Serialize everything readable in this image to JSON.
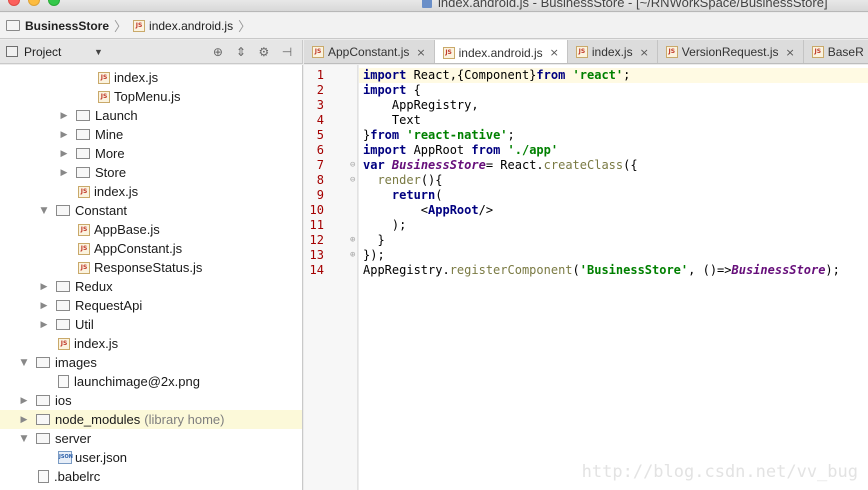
{
  "window": {
    "title": "index.android.js - BusinessStore - [~/RNWorkSpace/BusinessStore]"
  },
  "breadcrumb": {
    "project": "BusinessStore",
    "file": "index.android.js"
  },
  "project_panel": {
    "label": "Project"
  },
  "tabs": [
    {
      "label": "AppConstant.js",
      "active": false,
      "closable": true
    },
    {
      "label": "index.android.js",
      "active": true,
      "closable": true
    },
    {
      "label": "index.js",
      "active": false,
      "closable": true
    },
    {
      "label": "VersionRequest.js",
      "active": false,
      "closable": true
    },
    {
      "label": "BaseR",
      "active": false,
      "closable": false
    }
  ],
  "tree": [
    {
      "label": "index.js",
      "type": "js",
      "depth": 5
    },
    {
      "label": "TopMenu.js",
      "type": "js",
      "depth": 5
    },
    {
      "label": "Launch",
      "type": "folder",
      "depth": 3,
      "expanded": false
    },
    {
      "label": "Mine",
      "type": "folder",
      "depth": 3,
      "expanded": false
    },
    {
      "label": "More",
      "type": "folder",
      "depth": 3,
      "expanded": false
    },
    {
      "label": "Store",
      "type": "folder",
      "depth": 3,
      "expanded": false
    },
    {
      "label": "index.js",
      "type": "js",
      "depth": 4
    },
    {
      "label": "Constant",
      "type": "folder",
      "depth": 2,
      "expanded": true
    },
    {
      "label": "AppBase.js",
      "type": "js",
      "depth": 4
    },
    {
      "label": "AppConstant.js",
      "type": "js",
      "depth": 4
    },
    {
      "label": "ResponseStatus.js",
      "type": "js",
      "depth": 4
    },
    {
      "label": "Redux",
      "type": "folder",
      "depth": 2,
      "expanded": false
    },
    {
      "label": "RequestApi",
      "type": "folder",
      "depth": 2,
      "expanded": false
    },
    {
      "label": "Util",
      "type": "folder",
      "depth": 2,
      "expanded": false
    },
    {
      "label": "index.js",
      "type": "js",
      "depth": 3
    },
    {
      "label": "images",
      "type": "folder",
      "depth": 1,
      "expanded": true
    },
    {
      "label": "launchimage@2x.png",
      "type": "file",
      "depth": 3
    },
    {
      "label": "ios",
      "type": "folder",
      "depth": 1,
      "expanded": false
    },
    {
      "label": "node_modules",
      "type": "folder",
      "depth": 1,
      "expanded": false,
      "suffix": "(library home)",
      "highlight": true
    },
    {
      "label": "server",
      "type": "folder",
      "depth": 1,
      "expanded": true
    },
    {
      "label": "user.json",
      "type": "json",
      "depth": 3
    },
    {
      "label": ".babelrc",
      "type": "file",
      "depth": 2
    }
  ],
  "code": {
    "line_numbers": [
      "1",
      "2",
      "3",
      "4",
      "5",
      "6",
      "7",
      "8",
      "9",
      "10",
      "11",
      "12",
      "13",
      "14"
    ],
    "lines": [
      [
        [
          "kw",
          "import"
        ],
        [
          "p",
          " React,{Component}"
        ],
        [
          "kw",
          "from"
        ],
        [
          "p",
          " "
        ],
        [
          "str",
          "'react'"
        ],
        [
          "p",
          ";"
        ]
      ],
      [
        [
          "kw",
          "import"
        ],
        [
          "p",
          " {"
        ]
      ],
      [
        [
          "p",
          "    AppRegistry,"
        ]
      ],
      [
        [
          "p",
          "    Text"
        ]
      ],
      [
        [
          "p",
          "}"
        ],
        [
          "kw",
          "from"
        ],
        [
          "p",
          " "
        ],
        [
          "str",
          "'react-native'"
        ],
        [
          "p",
          ";"
        ]
      ],
      [
        [
          "kw",
          "import"
        ],
        [
          "p",
          " AppRoot "
        ],
        [
          "kw",
          "from"
        ],
        [
          "p",
          " "
        ],
        [
          "str",
          "'./app'"
        ]
      ],
      [
        [
          "kw",
          "var"
        ],
        [
          "p",
          " "
        ],
        [
          "ital",
          "BusinessStore"
        ],
        [
          "p",
          "= React."
        ],
        [
          "fn",
          "createClass"
        ],
        [
          "p",
          "({"
        ]
      ],
      [
        [
          "p",
          "  "
        ],
        [
          "fn",
          "render"
        ],
        [
          "p",
          "(){"
        ]
      ],
      [
        [
          "p",
          "    "
        ],
        [
          "kw",
          "return"
        ],
        [
          "p",
          "("
        ]
      ],
      [
        [
          "p",
          "        <"
        ],
        [
          "jsx",
          "AppRoot"
        ],
        [
          "p",
          "/>"
        ]
      ],
      [
        [
          "p",
          "    );"
        ]
      ],
      [
        [
          "p",
          "  }"
        ]
      ],
      [
        [
          "p",
          "});"
        ]
      ],
      [
        [
          "p",
          "AppRegistry."
        ],
        [
          "fn",
          "registerComponent"
        ],
        [
          "p",
          "("
        ],
        [
          "str",
          "'BusinessStore'"
        ],
        [
          "p",
          ", ()=>"
        ],
        [
          "ital",
          "BusinessStore"
        ],
        [
          "p",
          ");"
        ]
      ]
    ]
  },
  "watermark": "http://blog.csdn.net/vv_bug"
}
